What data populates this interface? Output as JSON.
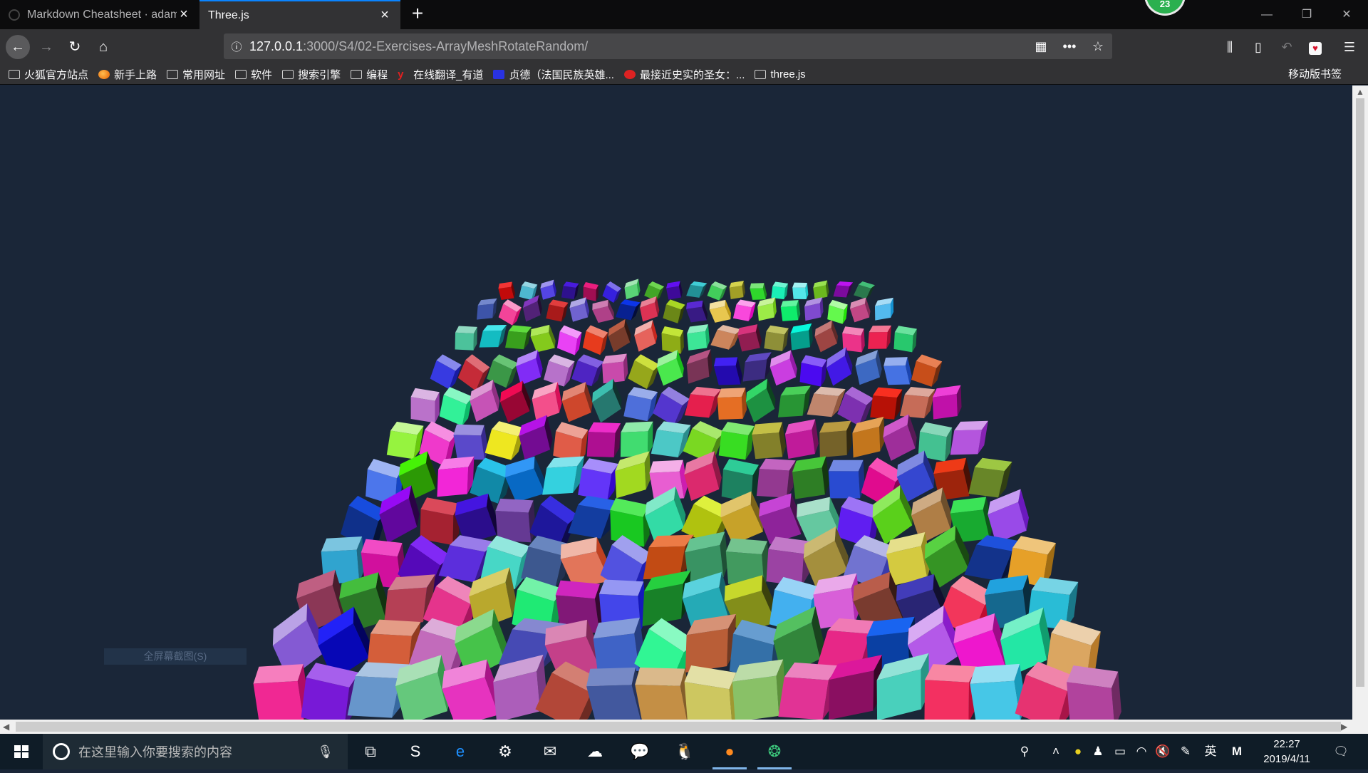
{
  "browser": {
    "tabs": [
      {
        "title": "Markdown Cheatsheet · adam-p/markdown-here Wiki",
        "active": false
      },
      {
        "title": "Three.js",
        "active": true
      }
    ],
    "badge_count": "23",
    "url": {
      "host": "127.0.0.1",
      "path": ":3000/S4/02-Exercises-ArrayMeshRotateRandom/"
    },
    "bookmarks": [
      {
        "label": "火狐官方站点",
        "icon": "folder-icon"
      },
      {
        "label": "新手上路",
        "icon": "firefox-icon"
      },
      {
        "label": "常用网址",
        "icon": "folder-icon"
      },
      {
        "label": "软件",
        "icon": "folder-icon"
      },
      {
        "label": "搜索引擎",
        "icon": "folder-icon"
      },
      {
        "label": "编程",
        "icon": "folder-icon"
      },
      {
        "label": "在线翻译_有道",
        "icon": "youdao-icon"
      },
      {
        "label": "贞德（法国民族英雄...",
        "icon": "baidu-icon"
      },
      {
        "label": "最接近史实的圣女：...",
        "icon": "red-icon"
      },
      {
        "label": "three.js",
        "icon": "folder-icon"
      }
    ],
    "mobile_bookmarks": "移动版书签"
  },
  "scene": {
    "background": "#1a2638",
    "grid": {
      "rows": 12,
      "cols": 18
    },
    "seed": 7,
    "snip_hint": "全屏幕截图(S)"
  },
  "taskbar": {
    "search_placeholder": "在这里输入你要搜索的内容",
    "time": "22:27",
    "date": "2019/4/11",
    "ime": "英"
  }
}
